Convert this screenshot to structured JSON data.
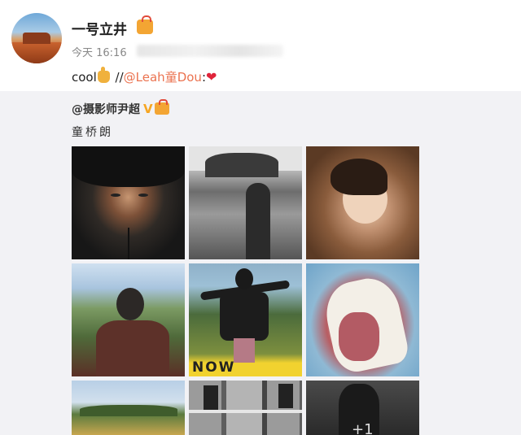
{
  "post": {
    "username": "一号立井",
    "time": "今天 16:16",
    "text_prefix": "cool",
    "text_separator": " //",
    "mention": "@Leah童Dou",
    "text_suffix": ":",
    "badge_icon": "vip-badge-icon",
    "heart_icon": "❤"
  },
  "repost": {
    "author": "@摄影师尹超",
    "verified_icon": "V",
    "text": "童桥朗",
    "photos": [
      {
        "name": "photo-1"
      },
      {
        "name": "photo-2"
      },
      {
        "name": "photo-3"
      },
      {
        "name": "photo-4"
      },
      {
        "name": "photo-5",
        "overlay_text": "NOW"
      },
      {
        "name": "photo-6"
      },
      {
        "name": "photo-7"
      },
      {
        "name": "photo-8"
      },
      {
        "name": "photo-9",
        "overlay_text": "+1"
      }
    ]
  }
}
